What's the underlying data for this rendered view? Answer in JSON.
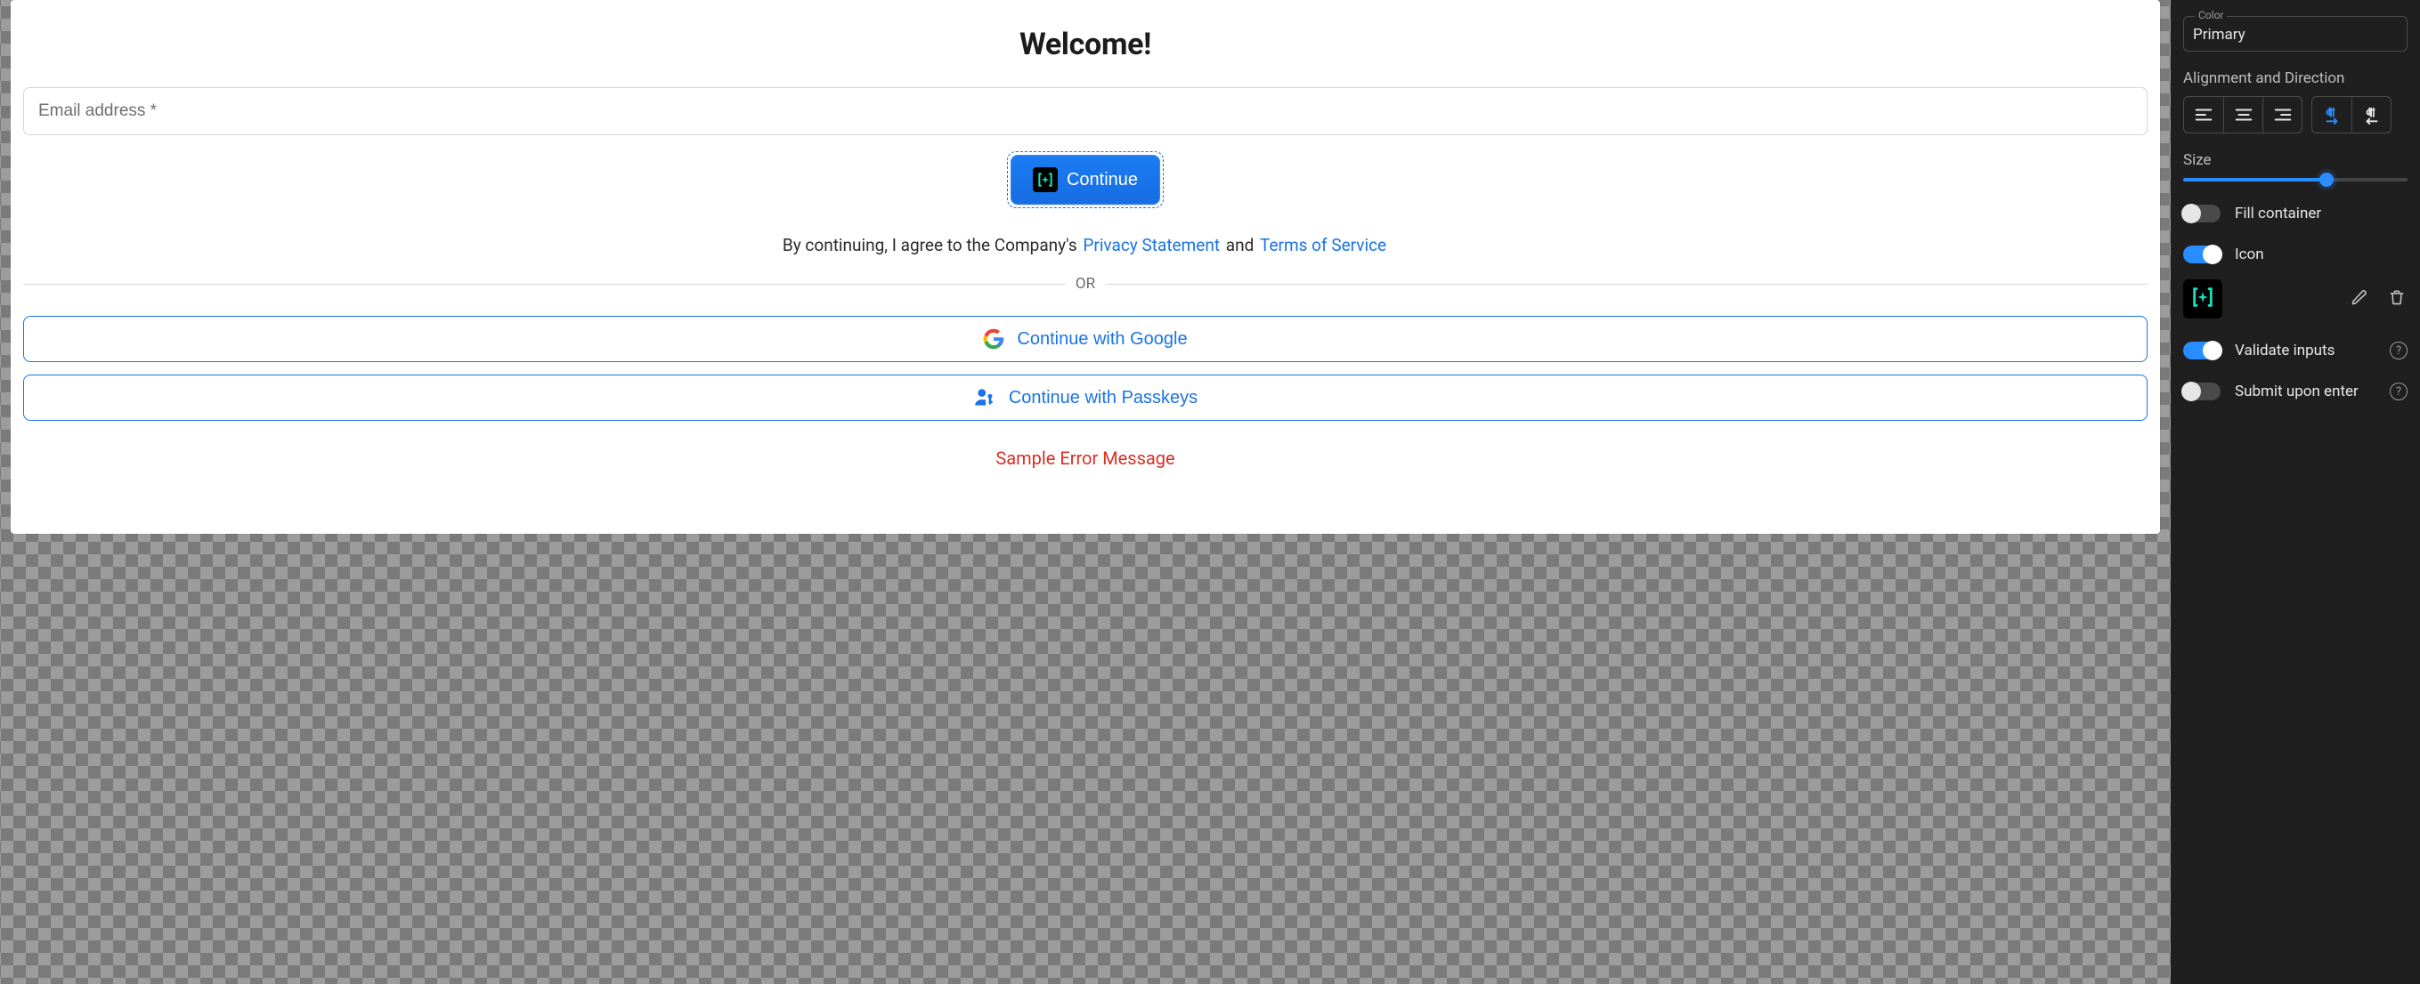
{
  "canvas": {
    "title": "Welcome!",
    "email_placeholder": "Email address *",
    "continue_label": "Continue",
    "legal_prefix": "By continuing, I agree to the Company's",
    "privacy_link": "Privacy Statement",
    "legal_joiner": "and",
    "tos_link": "Terms of Service",
    "divider_text": "OR",
    "google_label": "Continue with Google",
    "passkeys_label": "Continue with Passkeys",
    "error_text": "Sample Error Message"
  },
  "inspector": {
    "color_field_label": "Color",
    "color_value": "Primary",
    "alignment_section": "Alignment and Direction",
    "size_section": "Size",
    "size_percent": 64,
    "fill_container_label": "Fill container",
    "fill_container_on": false,
    "icon_label": "Icon",
    "icon_on": true,
    "validate_label": "Validate inputs",
    "validate_on": true,
    "submit_enter_label": "Submit upon enter",
    "submit_enter_on": false
  }
}
